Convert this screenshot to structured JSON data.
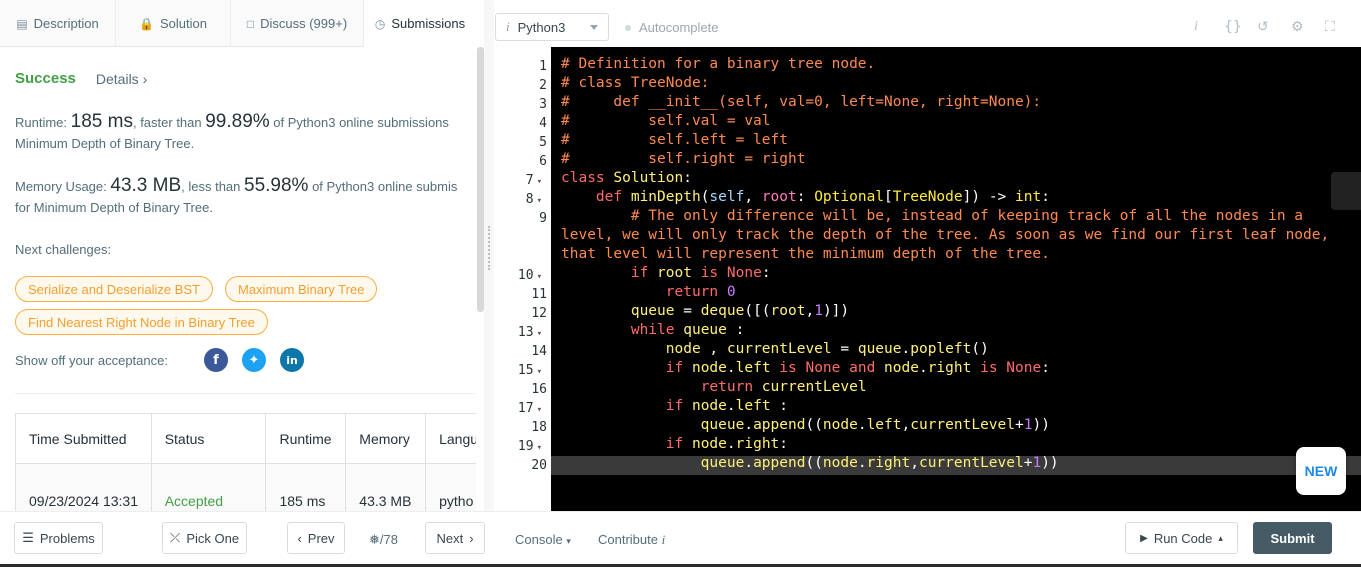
{
  "tabs": [
    {
      "label": "Description",
      "icon": "document-icon"
    },
    {
      "label": "Solution",
      "icon": "lock-icon"
    },
    {
      "label": "Discuss (999+)",
      "icon": "chat-icon"
    },
    {
      "label": "Submissions",
      "icon": "clock-icon"
    }
  ],
  "result": {
    "status": "Success",
    "details": "Details",
    "runtime": {
      "label": "Runtime:",
      "value": "185 ms",
      "mid": ", faster than ",
      "percent": "99.89%",
      "suffix": " of Python3 online submissions",
      "line2": "Minimum Depth of Binary Tree."
    },
    "memory": {
      "label": "Memory Usage:",
      "value": "43.3 MB",
      "mid": ", less than ",
      "percent": "55.98%",
      "suffix": " of Python3 online submis",
      "line2": "for Minimum Depth of Binary Tree."
    },
    "next_label": "Next challenges:",
    "challenges": [
      "Serialize and Deserialize BST",
      "Maximum Binary Tree",
      "Find Nearest Right Node in Binary Tree"
    ],
    "share_label": "Show off your acceptance:"
  },
  "table": {
    "headers": [
      "Time Submitted",
      "Status",
      "Runtime",
      "Memory",
      "Langu"
    ],
    "rows": [
      [
        "09/23/2024 13:31",
        "Accepted",
        "185 ms",
        "43.3 MB",
        "pytho"
      ]
    ]
  },
  "editor": {
    "language": "Python3",
    "autocomplete": "Autocomplete",
    "line_numbers": [
      "1",
      "2",
      "3",
      "4",
      "5",
      "6",
      "7",
      "8",
      "9",
      "10",
      "11",
      "12",
      "13",
      "14",
      "15",
      "16",
      "17",
      "18",
      "19",
      "20"
    ],
    "new_badge": "NEW"
  },
  "bottom": {
    "problems": "Problems",
    "pick_one": "Pick One",
    "prev": "Prev",
    "page": "/78",
    "next": "Next",
    "console": "Console",
    "contribute": "Contribute",
    "run_code": "Run Code",
    "submit": "Submit"
  },
  "colors": {
    "success": "#43a047",
    "chip": "#f0a030",
    "submit": "#455a64"
  }
}
